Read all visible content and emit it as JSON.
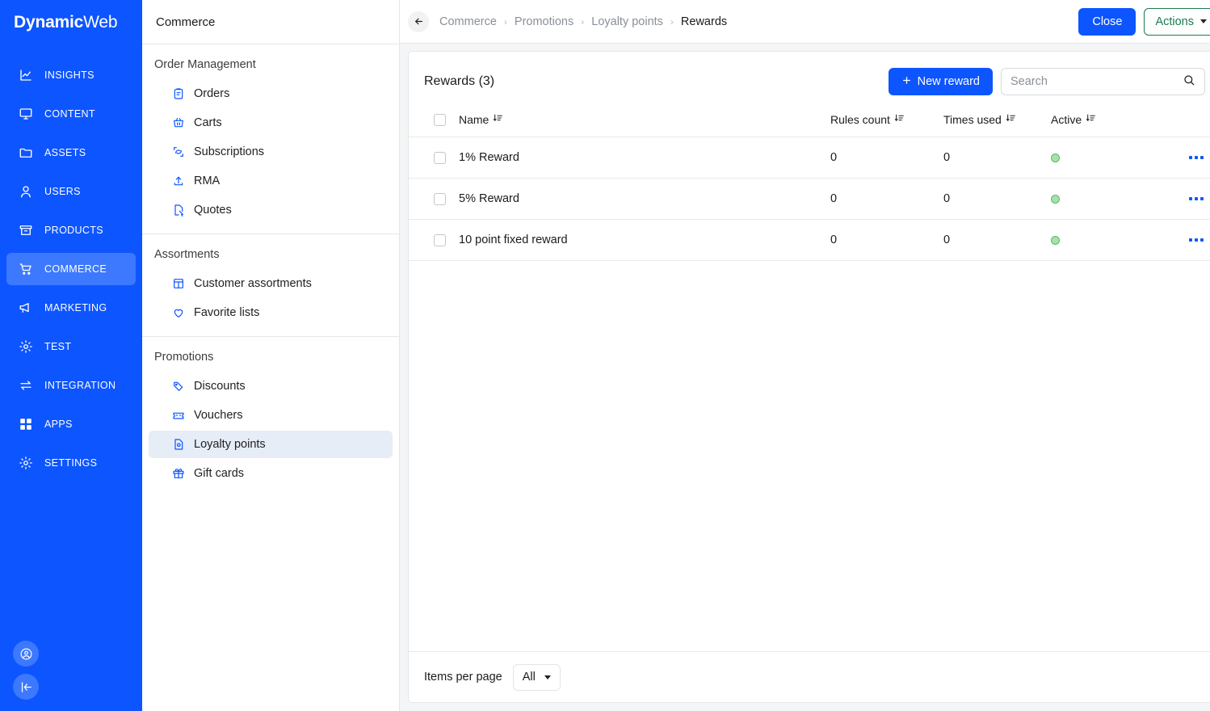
{
  "brand": {
    "bold": "Dynamic",
    "thin": "Web"
  },
  "primary_nav": {
    "items": [
      {
        "label": "INSIGHTS",
        "icon": "chart-line-icon",
        "active": false
      },
      {
        "label": "CONTENT",
        "icon": "monitor-icon",
        "active": false
      },
      {
        "label": "ASSETS",
        "icon": "folder-icon",
        "active": false
      },
      {
        "label": "USERS",
        "icon": "user-icon",
        "active": false
      },
      {
        "label": "PRODUCTS",
        "icon": "box-icon",
        "active": false
      },
      {
        "label": "COMMERCE",
        "icon": "cart-icon",
        "active": true
      },
      {
        "label": "MARKETING",
        "icon": "megaphone-icon",
        "active": false
      },
      {
        "label": "TEST",
        "icon": "gear-icon",
        "active": false
      },
      {
        "label": "INTEGRATION",
        "icon": "arrows-exchange-icon",
        "active": false
      },
      {
        "label": "APPS",
        "icon": "grid-icon",
        "active": false
      },
      {
        "label": "SETTINGS",
        "icon": "gear-icon",
        "active": false
      }
    ],
    "bottom": [
      {
        "icon": "account-circle-icon"
      },
      {
        "icon": "collapse-left-icon"
      }
    ]
  },
  "secondary_nav": {
    "title": "Commerce",
    "groups": [
      {
        "title": "Order Management",
        "items": [
          {
            "label": "Orders",
            "icon": "clipboard-icon",
            "active": false
          },
          {
            "label": "Carts",
            "icon": "basket-icon",
            "active": false
          },
          {
            "label": "Subscriptions",
            "icon": "refresh-box-icon",
            "active": false
          },
          {
            "label": "RMA",
            "icon": "upload-box-icon",
            "active": false
          },
          {
            "label": "Quotes",
            "icon": "document-cursor-icon",
            "active": false
          }
        ]
      },
      {
        "title": "Assortments",
        "items": [
          {
            "label": "Customer assortments",
            "icon": "layout-table-icon",
            "active": false
          },
          {
            "label": "Favorite lists",
            "icon": "heart-icon",
            "active": false
          }
        ]
      },
      {
        "title": "Promotions",
        "items": [
          {
            "label": "Discounts",
            "icon": "tag-icon",
            "active": false
          },
          {
            "label": "Vouchers",
            "icon": "ticket-icon",
            "active": false
          },
          {
            "label": "Loyalty points",
            "icon": "file-points-icon",
            "active": true
          },
          {
            "label": "Gift cards",
            "icon": "gift-icon",
            "active": false
          }
        ]
      }
    ]
  },
  "topbar": {
    "back_icon": "arrow-left-icon",
    "breadcrumb": [
      "Commerce",
      "Promotions",
      "Loyalty points",
      "Rewards"
    ],
    "separator": "›",
    "close_label": "Close",
    "actions_label": "Actions"
  },
  "panel": {
    "title": "Rewards (3)",
    "new_button_label": "New reward",
    "new_button_icon": "plus-icon",
    "search": {
      "placeholder": "Search",
      "value": "",
      "icon": "search-icon"
    },
    "sort_icon": "sort-descending-icon",
    "columns": [
      {
        "key": "name",
        "label": "Name",
        "sortable": true
      },
      {
        "key": "rules_count",
        "label": "Rules count",
        "sortable": true
      },
      {
        "key": "times_used",
        "label": "Times used",
        "sortable": true
      },
      {
        "key": "active",
        "label": "Active",
        "sortable": true
      }
    ],
    "rows": [
      {
        "name": "1% Reward",
        "rules_count": "0",
        "times_used": "0",
        "active": true
      },
      {
        "name": "5% Reward",
        "rules_count": "0",
        "times_used": "0",
        "active": true
      },
      {
        "name": "10 point fixed reward",
        "rules_count": "0",
        "times_used": "0",
        "active": true
      }
    ],
    "footer": {
      "items_per_page_label": "Items per page",
      "items_per_page_value": "All"
    }
  },
  "colors": {
    "brand_blue": "#0d55ff",
    "brand_blue_active": "#3c79ff",
    "green_outline": "#1a7a4e",
    "status_green_fill": "#a7e0ae",
    "status_green_border": "#5cb868",
    "sidebar_active_bg": "#e7edf7"
  }
}
